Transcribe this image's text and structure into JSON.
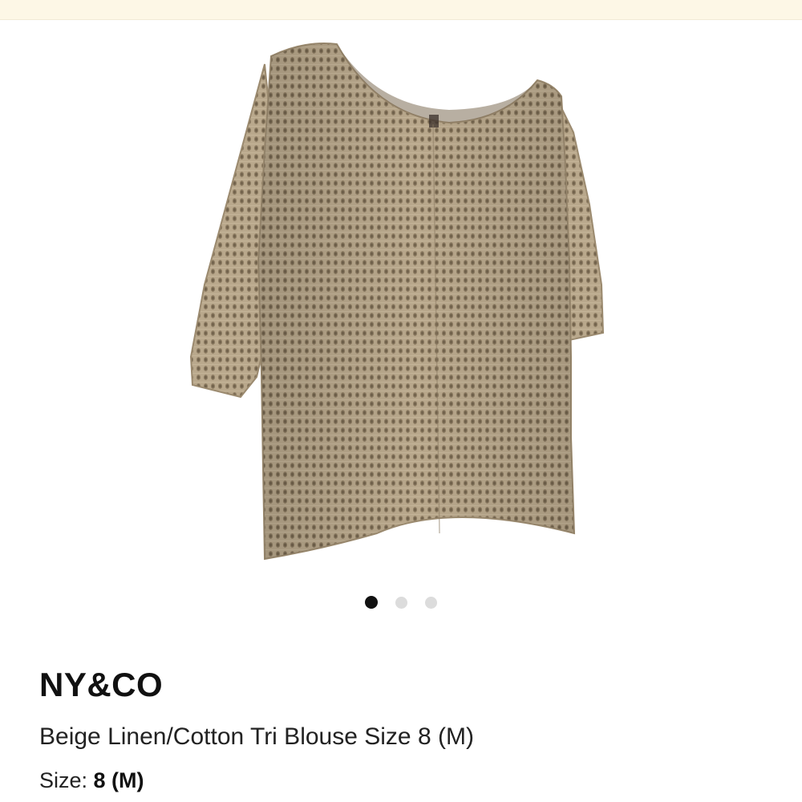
{
  "product": {
    "brand": "NY&CO",
    "title": "Beige Linen/Cotton Tri Blouse Size 8 (M)",
    "size_label": "Size:",
    "size_value": "8 (M)"
  },
  "gallery": {
    "image_count": 3,
    "active_index": 0,
    "image_subject": "beige knit short-sleeve sweater",
    "garment_color": "#b8a68a"
  },
  "colors": {
    "banner_bg": "#fdf7e6",
    "dot_active": "#111111",
    "dot_inactive": "#dcdcdc"
  }
}
